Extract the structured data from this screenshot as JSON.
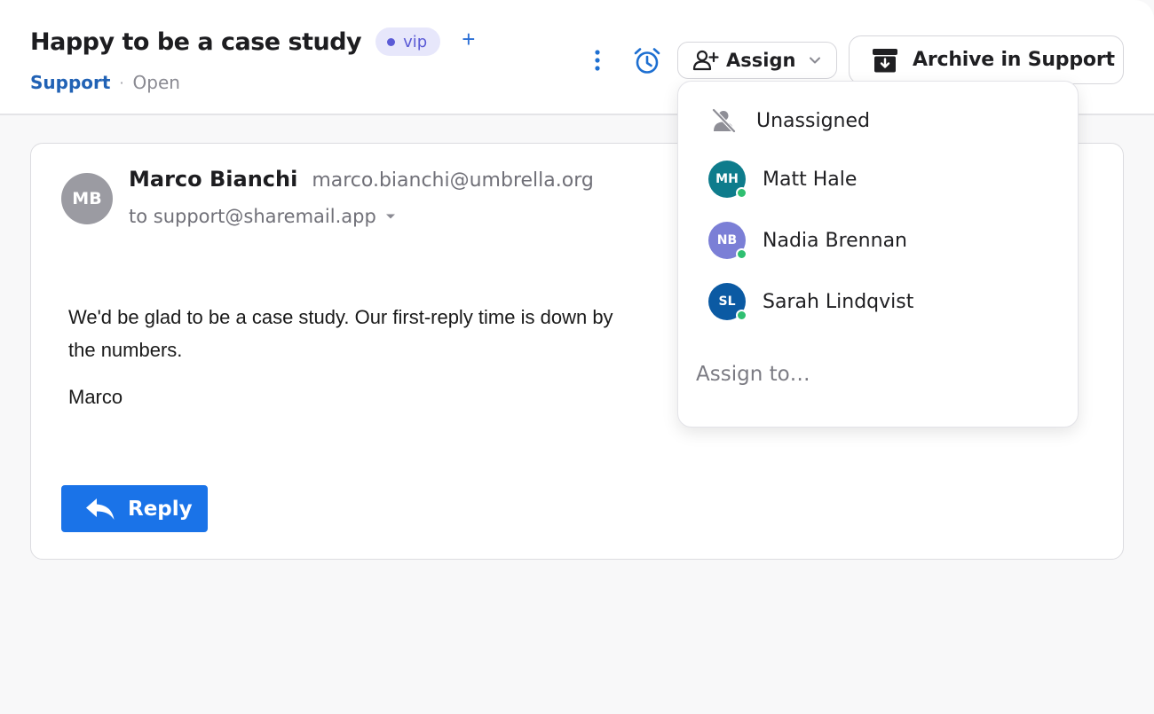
{
  "header": {
    "subject": "Happy to be a case study",
    "tag": "vip",
    "add_tag_symbol": "+",
    "inbox": "Support",
    "separator": "·",
    "status": "Open"
  },
  "toolbar": {
    "more_icon": "vertical-dots-icon",
    "snooze_icon": "alarm-clock-icon",
    "assign_label": "Assign",
    "archive_label": "Archive in Support"
  },
  "message": {
    "avatar_initials": "MB",
    "sender_name": "Marco Bianchi",
    "sender_email": "marco.bianchi@umbrella.org",
    "to_line": "to support@sharemail.app",
    "body": "We'd be glad to be a case study. Our first-reply time is down by",
    "body_cont": "the numbers.",
    "signoff": "Marco",
    "reply_label": "Reply"
  },
  "assign_menu": {
    "unassigned_label": "Unassigned",
    "people": [
      {
        "initials": "MH",
        "name": "Matt Hale",
        "color": "#0e7c8c"
      },
      {
        "initials": "NB",
        "name": "Nadia Brennan",
        "color": "#7b7fd6"
      },
      {
        "initials": "SL",
        "name": "Sarah Lindqvist",
        "color": "#0b5aa3"
      }
    ],
    "input_placeholder": "Assign to…"
  },
  "colors": {
    "accent_blue": "#1a73e8",
    "link_blue": "#2162b5",
    "vip_purple": "#5b5bd6",
    "online_green": "#2fbf71"
  }
}
